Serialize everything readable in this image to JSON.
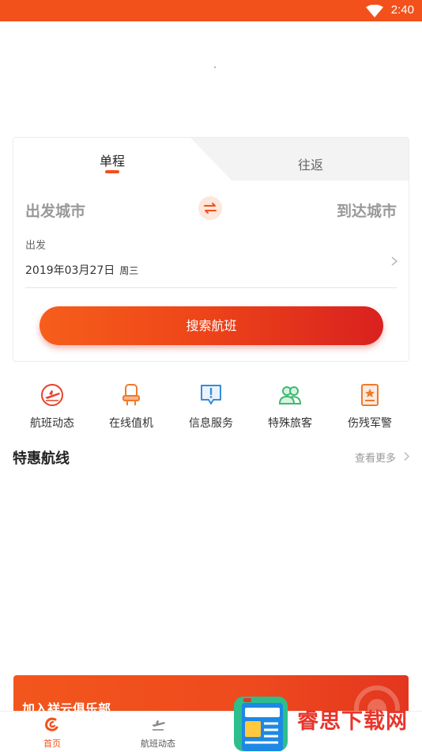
{
  "status_bar": {
    "time": "2:40",
    "wifi_icon": "wifi-icon",
    "color": "#F2511B"
  },
  "tabs": [
    {
      "label": "单程",
      "active": true
    },
    {
      "label": "往返",
      "active": false
    }
  ],
  "search": {
    "from_city": "出发城市",
    "to_city": "到达城市",
    "swap_icon": "swap-arrows-icon",
    "depart_label": "出发",
    "date": "2019年03月27日",
    "weekday": "周三",
    "button_label": "搜索航班"
  },
  "services": [
    {
      "label": "航班动态",
      "icon": "flight-status-icon"
    },
    {
      "label": "在线值机",
      "icon": "seat-checkin-icon"
    },
    {
      "label": "信息服务",
      "icon": "info-service-icon"
    },
    {
      "label": "特殊旅客",
      "icon": "special-passenger-icon"
    },
    {
      "label": "伤残军警",
      "icon": "military-police-icon"
    }
  ],
  "section": {
    "title": "特惠航线",
    "more_label": "查看更多"
  },
  "banner": {
    "text": "加入祥云俱乐部"
  },
  "bottom_nav": [
    {
      "label": "首页",
      "icon": "home-logo-icon",
      "active": true
    },
    {
      "label": "航班动态",
      "icon": "plane-icon",
      "active": false
    }
  ],
  "watermark": {
    "text": "睿思下载网"
  },
  "colors": {
    "accent": "#F2511B",
    "button_start": "#F65E1B",
    "button_end": "#D9211F",
    "inactive_text": "#999999"
  }
}
